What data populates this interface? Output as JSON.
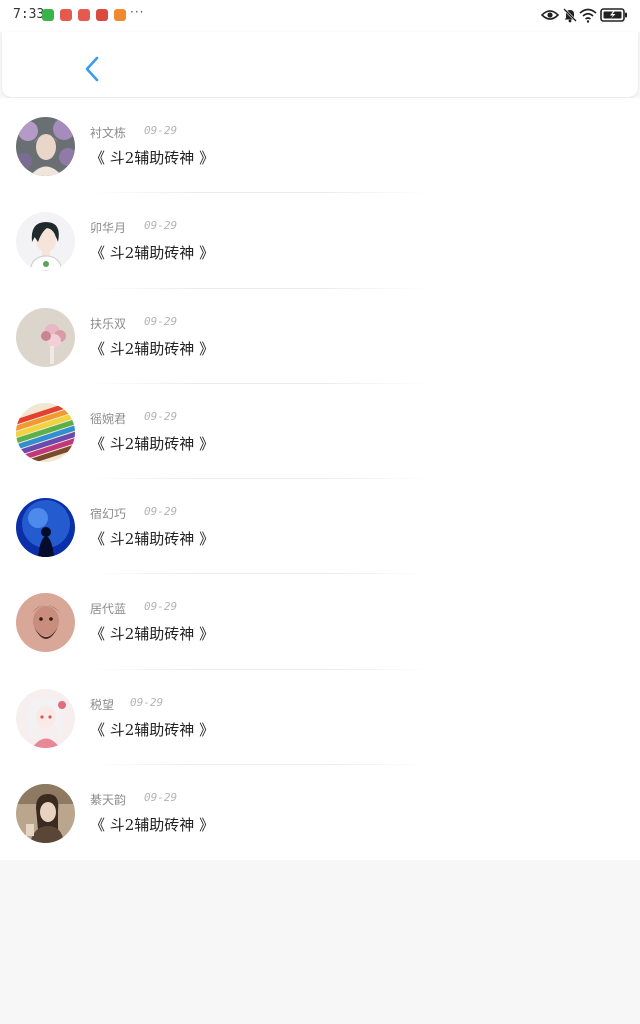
{
  "status_bar": {
    "time": "7:33",
    "more_indicator": "···",
    "icons": [
      "eye-icon",
      "bell-muted-icon",
      "wifi-icon",
      "battery-charging-icon"
    ]
  },
  "nav": {
    "back_icon": "chevron-left-icon",
    "accent_color": "#3a9bf0"
  },
  "items": [
    {
      "name": "衬文栋",
      "date": "09-29",
      "title": "《 斗2辅助砖神 》",
      "avatar": "flower-woman"
    },
    {
      "name": "卯华月",
      "date": "09-29",
      "title": "《 斗2辅助砖神 》",
      "avatar": "illustrated-girl"
    },
    {
      "name": "扶乐双",
      "date": "09-29",
      "title": "《 斗2辅助砖神 》",
      "avatar": "pink-flower"
    },
    {
      "name": "徭婉君",
      "date": "09-29",
      "title": "《 斗2辅助砖神 》",
      "avatar": "colored-pencils"
    },
    {
      "name": "宿幻巧",
      "date": "09-29",
      "title": "《 斗2辅助砖神 》",
      "avatar": "blue-aquarium-silhouette"
    },
    {
      "name": "居代蓝",
      "date": "09-29",
      "title": "《 斗2辅助砖神 》",
      "avatar": "bearded-warrior"
    },
    {
      "name": "税望",
      "date": "09-29",
      "title": "《 斗2辅助砖神 》",
      "avatar": "pink-anime-girl"
    },
    {
      "name": "綦天韵",
      "date": "09-29",
      "title": "《 斗2辅助砖神 》",
      "avatar": "sepia-woman"
    }
  ]
}
